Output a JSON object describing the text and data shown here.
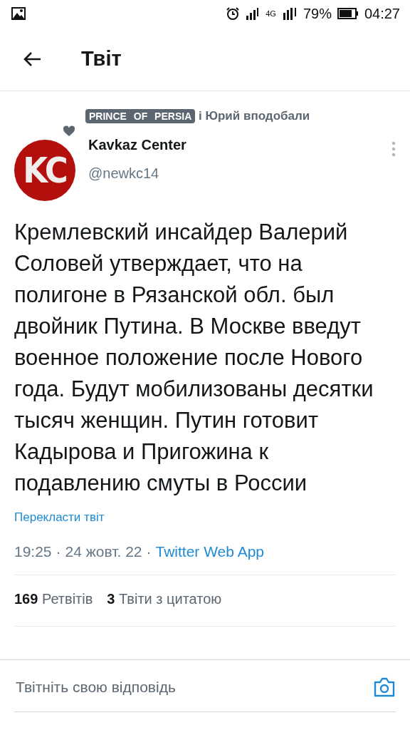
{
  "status_bar": {
    "network": "4G",
    "battery": "79%",
    "time": "04:27"
  },
  "header": {
    "title": "Твіт"
  },
  "liked_by": {
    "name": "PRINCE OF PERSIA",
    "rest": "і Юрий",
    "suffix": "вподобали"
  },
  "author": {
    "avatar_text": "KC",
    "name": "Kavkaz Center",
    "handle": "@newkc14"
  },
  "tweet": {
    "text": "Кремлевский инсайдер Валерий Соловей утверждает, что на полигоне в Рязанской обл. был двойник Путина. В Москве введут военное положение после Нового года. Будут мобилизованы десятки тысяч женщин. Путин готовит Кадырова и Пригожина к подавлению смуты в России",
    "translate": "Перекласти твіт",
    "time": "19:25",
    "date": "24 жовт. 22",
    "source": "Twitter Web App",
    "separator": "·"
  },
  "stats": [
    {
      "count": "169",
      "label": "Ретвітів"
    },
    {
      "count": "3",
      "label": "Твіти з цитатою"
    }
  ],
  "reply": {
    "placeholder": "Твітніть свою відповідь"
  }
}
